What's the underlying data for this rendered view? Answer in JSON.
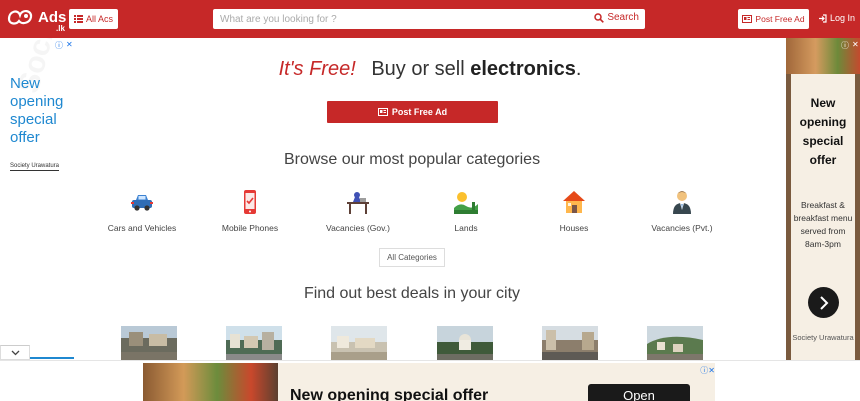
{
  "header": {
    "logo_text": "Ads",
    "logo_sub": ".lk",
    "all_ads_label": "All Acs",
    "search_placeholder": "What are you looking for ?",
    "search_label": "Search",
    "post_ad_label": "Post Free Ad",
    "login_label": "Log In"
  },
  "ad_left": {
    "headline": "New opening special offer",
    "brand": "Society Urawatura"
  },
  "ad_right": {
    "headline": "New opening special offer",
    "description": "Breakfast & breakfast menu served from 8am-3pm",
    "brand": "Society Urawatura"
  },
  "main": {
    "headline_free": "It's Free!",
    "headline_rest": "Buy or sell",
    "headline_bold": "electronics",
    "headline_end": ".",
    "post_button": "Post Free Ad",
    "browse_title": "Browse our most popular categories",
    "categories": [
      {
        "label": "Cars and Vehicles",
        "icon": "car-icon"
      },
      {
        "label": "Mobile Phones",
        "icon": "mobile-phone-icon"
      },
      {
        "label": "Vacancies (Gov.)",
        "icon": "office-desk-icon"
      },
      {
        "label": "Lands",
        "icon": "land-icon"
      },
      {
        "label": "Houses",
        "icon": "house-icon"
      },
      {
        "label": "Vacancies (Pvt.)",
        "icon": "businessman-icon"
      }
    ],
    "all_categories": "All Categories",
    "deals_title": "Find out best deals in your city"
  },
  "bottom_ad": {
    "headline": "New opening special offer",
    "button": "Open"
  },
  "colors": {
    "brand_red": "#c62828",
    "ad_blue": "#1f88d0"
  }
}
